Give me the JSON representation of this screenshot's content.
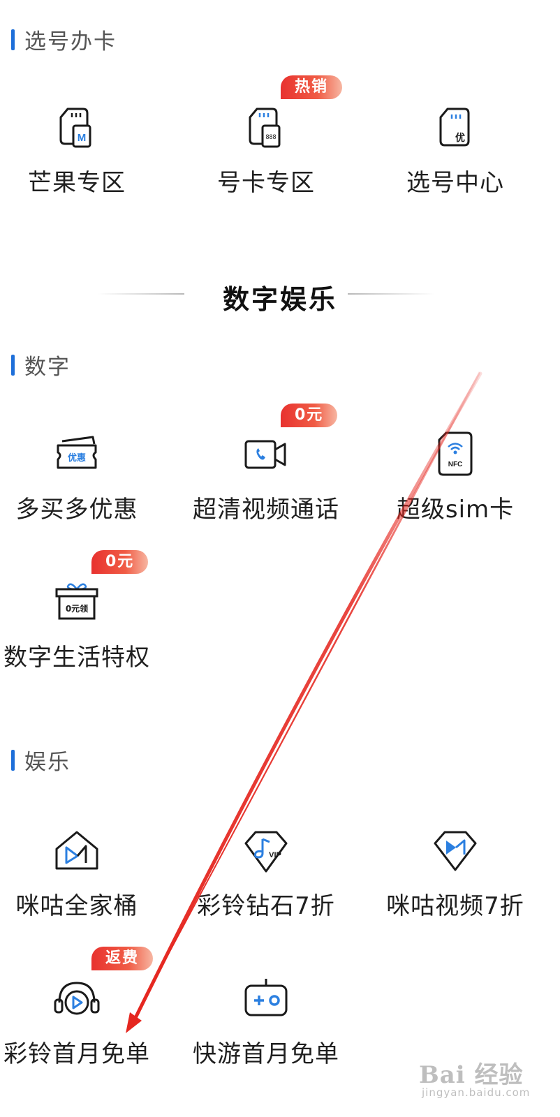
{
  "sections": {
    "number_card": {
      "title": "选号办卡",
      "items": [
        {
          "label": "芒果专区",
          "icon": "sim-m-icon"
        },
        {
          "label": "号卡专区",
          "icon": "sim-888-icon",
          "badge": "热销"
        },
        {
          "label": "选号中心",
          "icon": "sim-you-icon"
        }
      ]
    },
    "digital_entertainment_header": "数字娱乐",
    "digital": {
      "title": "数字",
      "items": [
        {
          "label": "多买多优惠",
          "icon": "coupon-icon",
          "icon_text": "优惠"
        },
        {
          "label": "超清视频通话",
          "icon": "video-call-icon",
          "badge": "0元"
        },
        {
          "label": "超级sim卡",
          "icon": "nfc-sim-icon",
          "icon_text": "NFC"
        },
        {
          "label": "数字生活特权",
          "icon": "gift-box-icon",
          "badge": "0元",
          "icon_text": "0元领"
        }
      ]
    },
    "entertainment": {
      "title": "娱乐",
      "items": [
        {
          "label": "咪咕全家桶",
          "icon": "migu-home-icon"
        },
        {
          "label": "彩铃钻石7折",
          "icon": "ringtone-vip-icon",
          "icon_text": "VIP"
        },
        {
          "label": "咪咕视频7折",
          "icon": "migu-video-icon"
        },
        {
          "label": "彩铃首月免单",
          "icon": "headphone-play-icon",
          "badge": "返费"
        },
        {
          "label": "快游首月免单",
          "icon": "gamepad-icon"
        }
      ]
    }
  },
  "sim_icon_texts": {
    "m": "M",
    "num": "888",
    "you": "优"
  },
  "watermark": {
    "main": "Bai 经验",
    "sub": "jingyan.baidu.com"
  },
  "colors": {
    "accent_blue": "#1e6fd9",
    "badge_red": "#e8322f",
    "arrow_red": "#e5261f"
  }
}
